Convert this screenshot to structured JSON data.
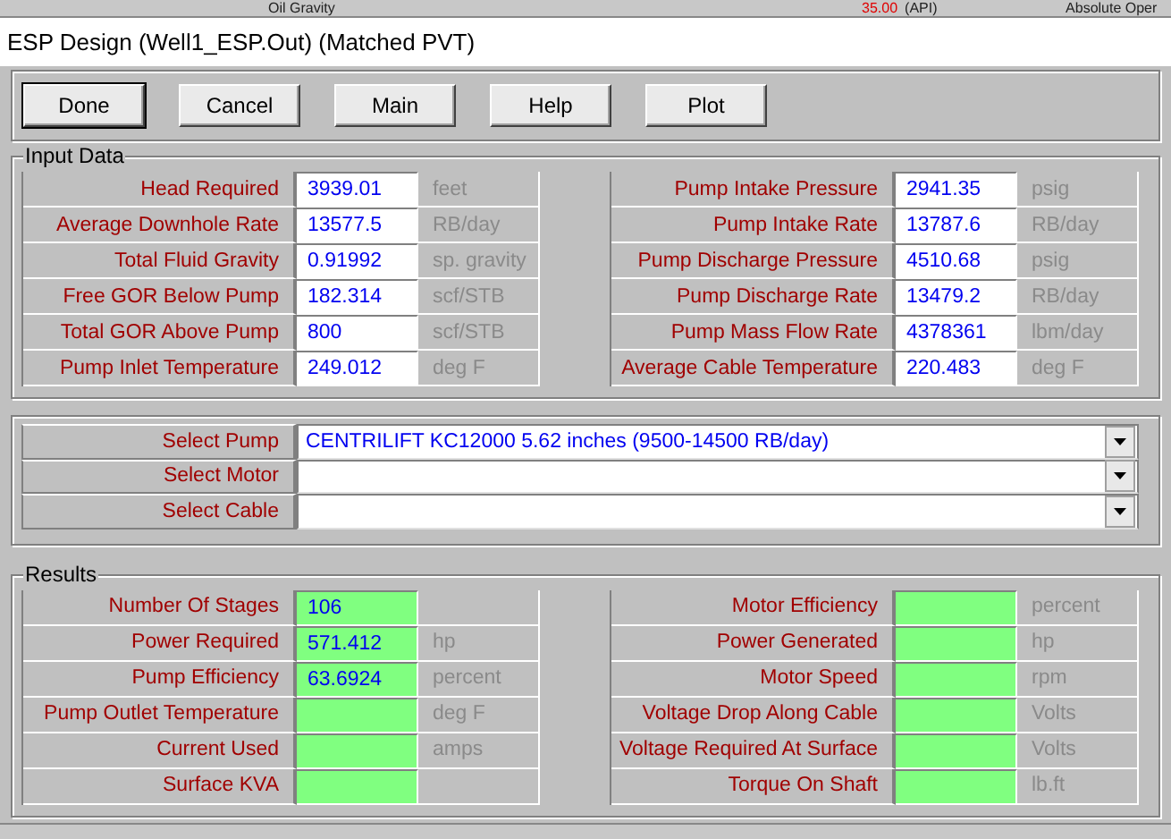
{
  "background_window": {
    "label": "Oil Gravity",
    "value": "35.00",
    "unit": "(API)",
    "column_3": "Absolute Oper"
  },
  "window": {
    "title": "ESP Design (Well1_ESP.Out) (Matched PVT)"
  },
  "buttons": [
    "Done",
    "Cancel",
    "Main",
    "Help",
    "Plot"
  ],
  "input_data": {
    "title": "Input Data",
    "kind": "input",
    "left": [
      {
        "label": "Head Required",
        "value": "3939.01",
        "unit": "feet"
      },
      {
        "label": "Average Downhole Rate",
        "value": "13577.5",
        "unit": "RB/day"
      },
      {
        "label": "Total Fluid Gravity",
        "value": "0.91992",
        "unit": "sp. gravity"
      },
      {
        "label": "Free GOR Below Pump",
        "value": "182.314",
        "unit": "scf/STB"
      },
      {
        "label": "Total GOR Above Pump",
        "value": "800",
        "unit": "scf/STB"
      },
      {
        "label": "Pump Inlet Temperature",
        "value": "249.012",
        "unit": "deg F"
      }
    ],
    "right": [
      {
        "label": "Pump Intake Pressure",
        "value": "2941.35",
        "unit": "psig"
      },
      {
        "label": "Pump Intake Rate",
        "value": "13787.6",
        "unit": "RB/day"
      },
      {
        "label": "Pump Discharge Pressure",
        "value": "4510.68",
        "unit": "psig"
      },
      {
        "label": "Pump Discharge Rate",
        "value": "13479.2",
        "unit": "RB/day"
      },
      {
        "label": "Pump Mass Flow Rate",
        "value": "4378361",
        "unit": "lbm/day"
      },
      {
        "label": "Average Cable Temperature",
        "value": "220.483",
        "unit": "deg F"
      }
    ]
  },
  "selections": [
    {
      "label": "Select Pump",
      "value": "CENTRILIFT KC12000 5.62 inches (9500-14500 RB/day)"
    },
    {
      "label": "Select Motor"
    },
    {
      "label": "Select Cable"
    }
  ],
  "results": {
    "title": "Results",
    "kind": "result",
    "left": [
      {
        "label": "Number Of Stages",
        "value": "106"
      },
      {
        "label": "Power Required",
        "value": "571.412",
        "unit": "hp"
      },
      {
        "label": "Pump Efficiency",
        "value": "63.6924",
        "unit": "percent"
      },
      {
        "label": "Pump Outlet Temperature",
        "unit": "deg F"
      },
      {
        "label": "Current Used",
        "unit": "amps"
      },
      {
        "label": "Surface KVA"
      }
    ],
    "right": [
      {
        "label": "Motor Efficiency",
        "unit": "percent"
      },
      {
        "label": "Power Generated",
        "unit": "hp"
      },
      {
        "label": "Motor Speed",
        "unit": "rpm"
      },
      {
        "label": "Voltage Drop Along Cable",
        "unit": "Volts"
      },
      {
        "label": "Voltage Required At Surface",
        "unit": "Volts"
      },
      {
        "label": "Torque On Shaft",
        "unit": "lb.ft"
      }
    ]
  }
}
